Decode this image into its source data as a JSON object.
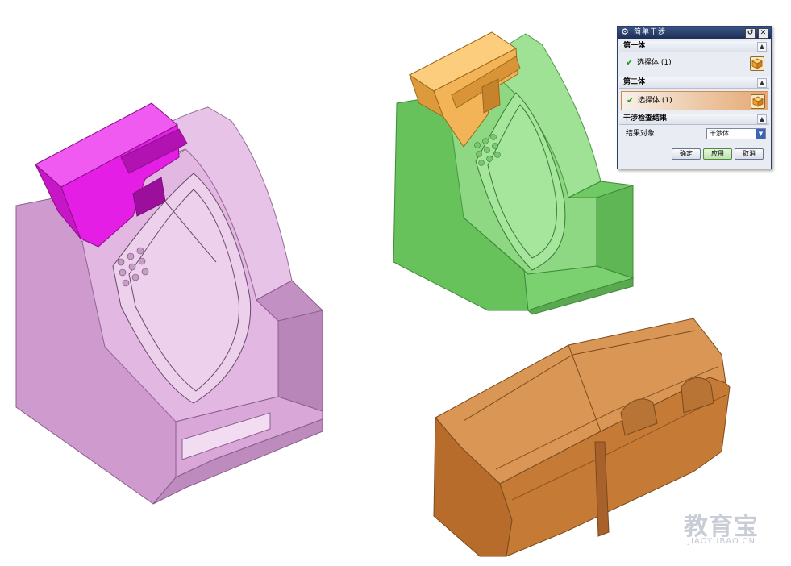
{
  "dialog": {
    "title": "简单干涉",
    "sections": {
      "first_body": {
        "header": "第一体",
        "value": "选择体 (1)"
      },
      "second_body": {
        "header": "第二体",
        "value": "选择体 (1)"
      },
      "result": {
        "header": "干涉检查结果",
        "label": "结果对象",
        "value": "干涉体"
      }
    },
    "buttons": {
      "ok": "确定",
      "apply": "应用",
      "cancel": "取消"
    }
  },
  "watermark": {
    "cn": "教育宝",
    "en": "JIAOYUBAO.CN"
  },
  "colors": {
    "pink_mold": "#dcb0dc",
    "magenta_part": "#e41ee4",
    "green_mold": "#84d67a",
    "orange_part": "#f2b457",
    "brown_body": "#c57a35",
    "dialog_title": "#1d2f57"
  }
}
